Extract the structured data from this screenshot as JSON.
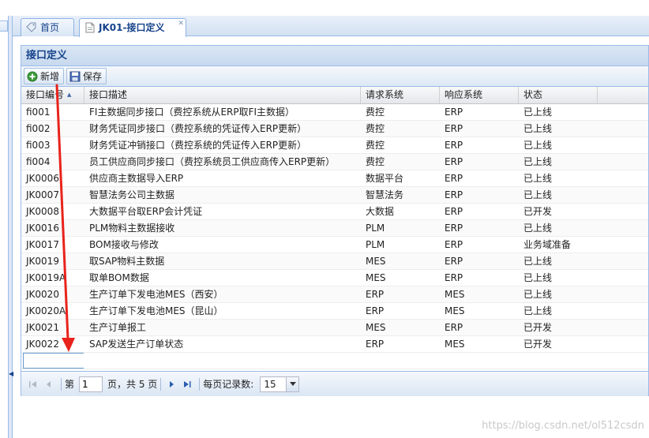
{
  "tabs": [
    {
      "label": "首页",
      "icon": "tag-icon"
    },
    {
      "label": "JK01-接口定义",
      "icon": "page-icon",
      "closable": true,
      "active": true
    }
  ],
  "panel": {
    "title": "接口定义"
  },
  "toolbar": {
    "add_label": "新增",
    "save_label": "保存"
  },
  "grid": {
    "columns": [
      "接口编号",
      "接口描述",
      "请求系统",
      "响应系统",
      "状态"
    ],
    "sort_column": 0,
    "rows": [
      [
        "fi001",
        "FI主数据同步接口（费控系统从ERP取FI主数据）",
        "费控",
        "ERP",
        "已上线"
      ],
      [
        "fi002",
        "财务凭证同步接口（费控系统的凭证传入ERP更新）",
        "费控",
        "ERP",
        "已上线"
      ],
      [
        "fi003",
        "财务凭证冲销接口（费控系统的凭证传入ERP更新）",
        "费控",
        "ERP",
        "已上线"
      ],
      [
        "fi004",
        "员工供应商同步接口（费控系统员工供应商传入ERP更新）",
        "费控",
        "ERP",
        "已上线"
      ],
      [
        "JK0006",
        "供应商主数据导入ERP",
        "数据平台",
        "ERP",
        "已上线"
      ],
      [
        "JK0007",
        "智慧法务公司主数据",
        "智慧法务",
        "ERP",
        "已上线"
      ],
      [
        "JK0008",
        "大数据平台取ERP会计凭证",
        "大数据",
        "ERP",
        "已开发"
      ],
      [
        "JK0016",
        "PLM物料主数据接收",
        "PLM",
        "ERP",
        "已上线"
      ],
      [
        "JK0017",
        "BOM接收与修改",
        "PLM",
        "ERP",
        "业务域准备"
      ],
      [
        "JK0019",
        "取SAP物料主数据",
        "MES",
        "ERP",
        "已上线"
      ],
      [
        "JK0019A",
        "取单BOM数据",
        "MES",
        "ERP",
        "已上线"
      ],
      [
        "JK0020",
        "生产订单下发电池MES（西安）",
        "ERP",
        "MES",
        "已上线"
      ],
      [
        "JK0020A",
        "生产订单下发电池MES（昆山）",
        "ERP",
        "MES",
        "已上线"
      ],
      [
        "JK0021",
        "生产订单报工",
        "MES",
        "ERP",
        "已开发"
      ],
      [
        "JK0022",
        "SAP发送生产订单状态",
        "ERP",
        "MES",
        "已开发"
      ]
    ],
    "new_row_value": ""
  },
  "paging": {
    "page_prefix": "第",
    "page_value": "1",
    "page_suffix": "页，共 5 页",
    "page_size_label": "每页记录数:",
    "page_size_value": "15"
  },
  "watermark": "https://blog.csdn.net/ol512csdn",
  "colors": {
    "accent": "#15428b",
    "border": "#99bbe8",
    "annotation": "#e8231b"
  }
}
